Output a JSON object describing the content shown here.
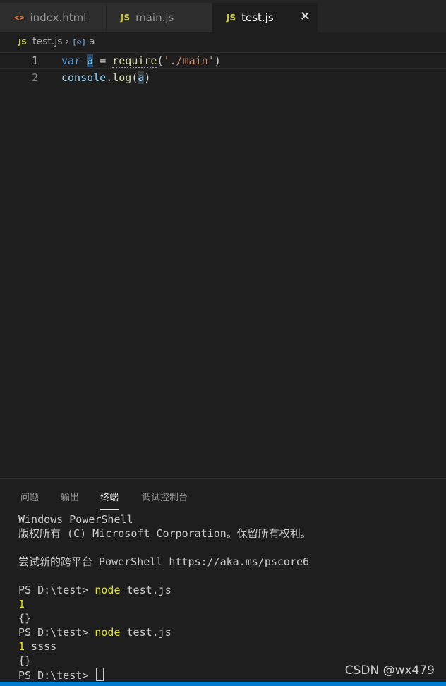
{
  "tabs": [
    {
      "label": "index.html",
      "icon": "html-icon",
      "icon_glyph": "<>"
    },
    {
      "label": "main.js",
      "icon": "js-icon",
      "icon_glyph": "JS"
    },
    {
      "label": "test.js",
      "icon": "js-icon",
      "icon_glyph": "JS",
      "active": true,
      "close_glyph": "✕"
    }
  ],
  "breadcrumb": {
    "file_icon": "JS",
    "file": "test.js",
    "separator": "›",
    "symbol_icon": "[⊘]",
    "symbol": "a"
  },
  "editor": {
    "lines": [
      {
        "number": "1",
        "tokens": [
          "var",
          "a",
          "=",
          "require",
          "(",
          "'./main'",
          ")"
        ]
      },
      {
        "number": "2",
        "tokens": [
          "console",
          ".",
          "log",
          "(",
          "a",
          ")"
        ]
      }
    ]
  },
  "panel": {
    "tabs": [
      "问题",
      "输出",
      "终端",
      "调试控制台"
    ],
    "active_tab": "终端"
  },
  "terminal": {
    "lines": [
      "Windows PowerShell",
      "版权所有 (C) Microsoft Corporation。保留所有权利。",
      "",
      "尝试新的跨平台 PowerShell https://aka.ms/pscore6",
      "",
      {
        "prompt": "PS D:\\test> ",
        "cmd": "node",
        "args": " test.js"
      },
      {
        "num": "1",
        "rest": ""
      },
      "{}",
      {
        "prompt": "PS D:\\test> ",
        "cmd": "node",
        "args": " test.js"
      },
      {
        "num": "1",
        "rest": " ssss"
      },
      "{}",
      {
        "prompt": "PS D:\\test> ",
        "cursor": true
      }
    ]
  },
  "watermark": "CSDN @wx479",
  "colors": {
    "background": "#1e1e1e",
    "accent": "#007acc",
    "keyword": "#569cd6",
    "string": "#ce9178",
    "function": "#dcdcaa",
    "terminal_highlight": "#e5e510"
  }
}
